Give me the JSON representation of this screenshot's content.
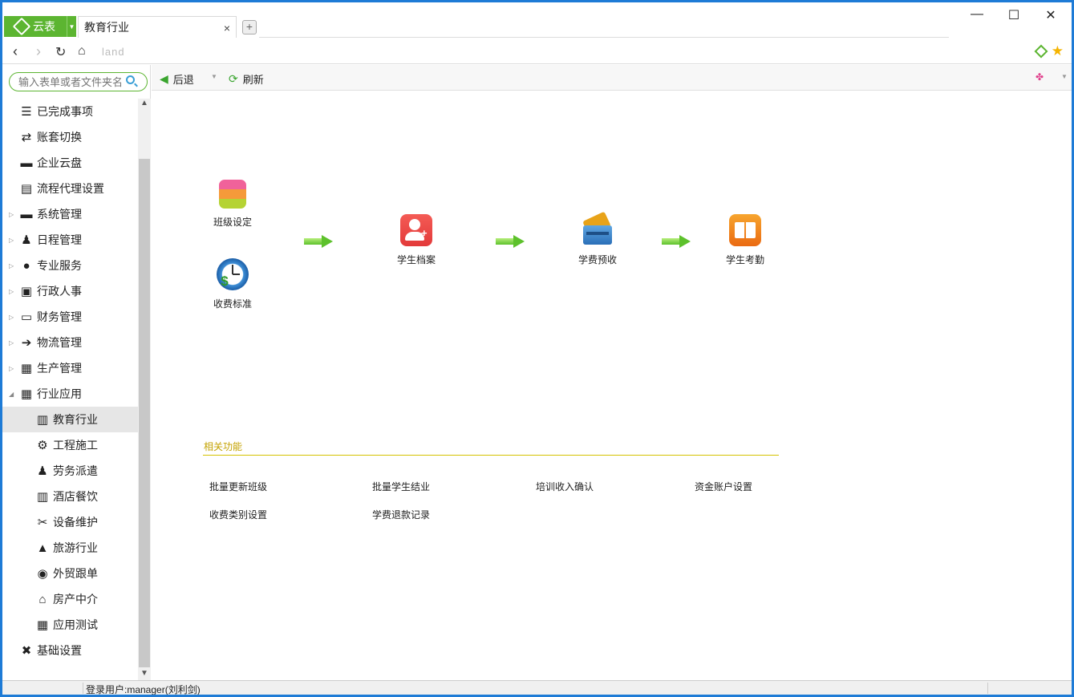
{
  "app": {
    "name": "云表"
  },
  "tab": {
    "title": "教育行业",
    "close": "×"
  },
  "window": {
    "minimize": "—",
    "maximize": "☐",
    "close": "✕"
  },
  "address": {
    "url": "land"
  },
  "search": {
    "placeholder": "输入表单或者文件夹名"
  },
  "sidebar": {
    "items": [
      {
        "label": "已完成事项",
        "icon": "list-icon"
      },
      {
        "label": "账套切换",
        "icon": "switch-icon"
      },
      {
        "label": "企业云盘",
        "icon": "folder-icon"
      },
      {
        "label": "流程代理设置",
        "icon": "document-icon"
      },
      {
        "label": "系统管理",
        "icon": "folder-icon",
        "expandable": true
      },
      {
        "label": "日程管理",
        "icon": "user-calendar-icon",
        "expandable": true
      },
      {
        "label": "专业服务",
        "icon": "user-icon",
        "expandable": true
      },
      {
        "label": "行政人事",
        "icon": "contact-card-icon",
        "expandable": true
      },
      {
        "label": "财务管理",
        "icon": "finance-icon",
        "expandable": true
      },
      {
        "label": "物流管理",
        "icon": "logistics-icon",
        "expandable": true
      },
      {
        "label": "生产管理",
        "icon": "production-icon",
        "expandable": true
      },
      {
        "label": "行业应用",
        "icon": "grid-icon",
        "expanded": true
      },
      {
        "label": "教育行业",
        "icon": "building-icon",
        "sub": true,
        "active": true
      },
      {
        "label": "工程施工",
        "icon": "gear-icon",
        "sub": true
      },
      {
        "label": "劳务派遣",
        "icon": "worker-icon",
        "sub": true
      },
      {
        "label": "酒店餐饮",
        "icon": "building-icon",
        "sub": true
      },
      {
        "label": "设备维护",
        "icon": "tools-icon",
        "sub": true
      },
      {
        "label": "旅游行业",
        "icon": "bag-icon",
        "sub": true
      },
      {
        "label": "外贸跟单",
        "icon": "globe-icon",
        "sub": true
      },
      {
        "label": "房产中介",
        "icon": "home-icon",
        "sub": true
      },
      {
        "label": "应用测试",
        "icon": "grid-icon",
        "sub": true
      },
      {
        "label": "基础设置",
        "icon": "wrench-icon"
      }
    ]
  },
  "toolbar": {
    "back_label": "后退",
    "refresh_label": "刷新"
  },
  "flow": {
    "class_setting": "班级设定",
    "fee_standard": "收费标准",
    "student_file": "学生档案",
    "tuition_prepay": "学费预收",
    "attendance": "学生考勤"
  },
  "related": {
    "title": "相关功能",
    "links": [
      "批量更新班级",
      "批量学生结业",
      "培训收入确认",
      "资金账户设置",
      "收费类别设置",
      "学费退款记录"
    ]
  },
  "status": {
    "user": "登录用户:manager(刘利剑)"
  },
  "colors": {
    "accent": "#5cb531",
    "window_border": "#1e7bd6",
    "related_title": "#c4a200"
  }
}
